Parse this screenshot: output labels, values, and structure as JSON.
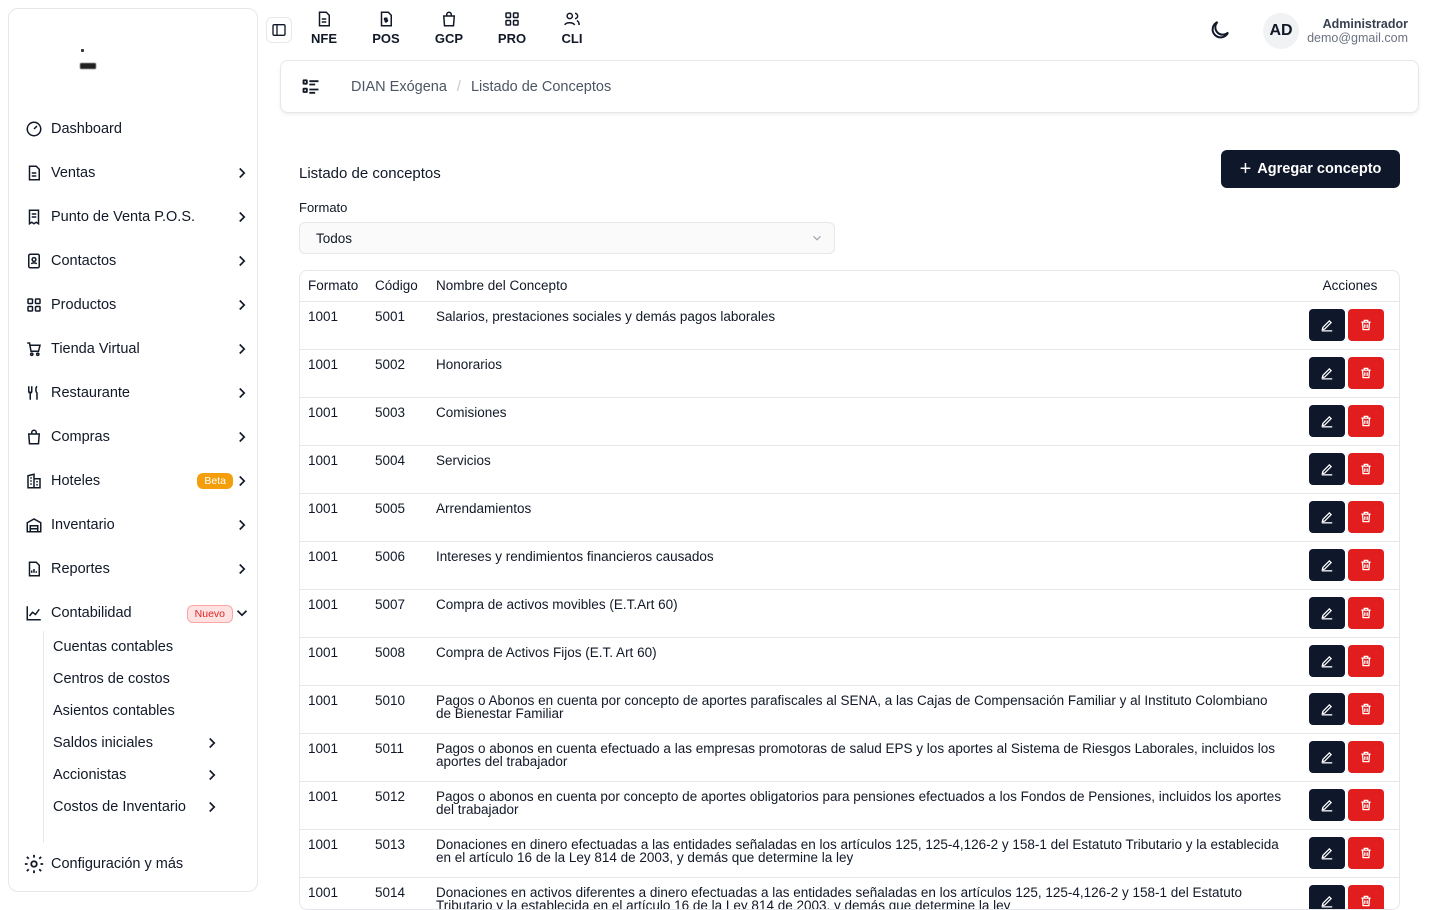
{
  "sidebar": {
    "items": [
      {
        "label": "Dashboard"
      },
      {
        "label": "Ventas"
      },
      {
        "label": "Punto de Venta P.O.S."
      },
      {
        "label": "Contactos"
      },
      {
        "label": "Productos"
      },
      {
        "label": "Tienda Virtual"
      },
      {
        "label": "Restaurante"
      },
      {
        "label": "Compras"
      },
      {
        "label": "Hoteles",
        "badge": "Beta"
      },
      {
        "label": "Inventario"
      },
      {
        "label": "Reportes"
      },
      {
        "label": "Contabilidad",
        "badge": "Nuevo"
      }
    ],
    "sub_items": [
      {
        "label": "Cuentas contables"
      },
      {
        "label": "Centros de costos"
      },
      {
        "label": "Asientos contables"
      },
      {
        "label": "Saldos iniciales"
      },
      {
        "label": "Accionistas"
      },
      {
        "label": "Costos de Inventario"
      }
    ],
    "config_label": "Configuración y más"
  },
  "topbar": {
    "modules": [
      {
        "label": "NFE"
      },
      {
        "label": "POS"
      },
      {
        "label": "GCP"
      },
      {
        "label": "PRO"
      },
      {
        "label": "CLI"
      }
    ],
    "avatar_initials": "AD",
    "user_name": "Administrador",
    "user_email": "demo@gmail.com"
  },
  "breadcrumb": {
    "parent": "DIAN Exógena",
    "current": "Listado de Conceptos"
  },
  "main": {
    "title": "Listado de conceptos",
    "add_button": "Agregar concepto",
    "filter_label": "Formato",
    "filter_value": "Todos"
  },
  "table": {
    "headers": {
      "formato": "Formato",
      "codigo": "Código",
      "nombre": "Nombre del Concepto",
      "acciones": "Acciones"
    },
    "rows": [
      {
        "formato": "1001",
        "codigo": "5001",
        "nombre": "Salarios, prestaciones sociales y demás pagos laborales"
      },
      {
        "formato": "1001",
        "codigo": "5002",
        "nombre": "Honorarios"
      },
      {
        "formato": "1001",
        "codigo": "5003",
        "nombre": "Comisiones"
      },
      {
        "formato": "1001",
        "codigo": "5004",
        "nombre": "Servicios"
      },
      {
        "formato": "1001",
        "codigo": "5005",
        "nombre": "Arrendamientos"
      },
      {
        "formato": "1001",
        "codigo": "5006",
        "nombre": "Intereses y rendimientos financieros causados"
      },
      {
        "formato": "1001",
        "codigo": "5007",
        "nombre": "Compra de activos movibles (E.T.Art 60)"
      },
      {
        "formato": "1001",
        "codigo": "5008",
        "nombre": "Compra de Activos Fijos (E.T. Art 60)"
      },
      {
        "formato": "1001",
        "codigo": "5010",
        "nombre": "Pagos o Abonos en cuenta por concepto de aportes parafiscales al SENA, a las Cajas de Compensación Familiar y al Instituto Colombiano de Bienestar Familiar"
      },
      {
        "formato": "1001",
        "codigo": "5011",
        "nombre": "Pagos o abonos en cuenta efectuado a las empresas promotoras de salud EPS y los aportes al Sistema de Riesgos Laborales, incluidos los aportes del trabajador"
      },
      {
        "formato": "1001",
        "codigo": "5012",
        "nombre": "Pagos o abonos en cuenta por concepto de aportes obligatorios para pensiones efectuados a los Fondos de Pensiones, incluidos los aportes del trabajador"
      },
      {
        "formato": "1001",
        "codigo": "5013",
        "nombre": "Donaciones en dinero efectuadas a las entidades señaladas en los artículos 125, 125-4,126-2 y 158-1 del Estatuto Tributario y la establecida en el artículo 16 de la Ley 814 de 2003, y demás que determine la ley"
      },
      {
        "formato": "1001",
        "codigo": "5014",
        "nombre": "Donaciones en activos diferentes a dinero efectuadas a las entidades señaladas en los artículos 125, 125-4,126-2 y 158-1 del Estatuto Tributario y la establecida en el artículo 16 de la Ley 814 de 2003, y demás que determine la ley"
      }
    ]
  }
}
